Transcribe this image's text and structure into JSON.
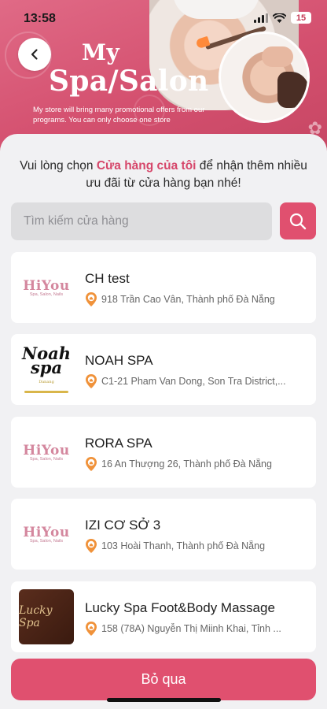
{
  "status_bar": {
    "time": "13:58",
    "battery": "15"
  },
  "header": {
    "title_line1": "My",
    "title_line2": "Spa/Salon",
    "subtitle": "My store will bring many promotional offers from our programs. You can only choose one store"
  },
  "prompt": {
    "before": "Vui lòng chọn ",
    "highlight": "Cửa hàng của tôi",
    "after": " để nhận thêm nhiều ưu đãi từ cửa hàng bạn nhé!"
  },
  "search": {
    "placeholder": "Tìm kiếm cửa hàng",
    "value": ""
  },
  "logos": {
    "hiyou_main": "HiYou",
    "hiyou_tagline": "Spa, Salon, Nails",
    "noah_main": "Noah spa",
    "noah_sub": "Danang",
    "lucky_main": "Lucky Spa"
  },
  "stores": [
    {
      "name": "CH test",
      "address": "918 Trần Cao Vân, Thành phố Đà Nẵng",
      "logo": "hiyou"
    },
    {
      "name": "NOAH SPA",
      "address": "C1-21 Pham Van Dong, Son Tra District,...",
      "logo": "noah"
    },
    {
      "name": "RORA SPA",
      "address": "16 An Thượng 26, Thành phố Đà Nẵng",
      "logo": "hiyou"
    },
    {
      "name": "IZI CƠ SỞ 3",
      "address": "103 Hoài Thanh, Thành phố Đà Nẵng",
      "logo": "hiyou"
    },
    {
      "name": "Lucky Spa Foot&Body Massage",
      "address": "158 (78A) Nguyễn Thị Miinh Khai, Tỉnh ...",
      "logo": "lucky"
    }
  ],
  "footer": {
    "skip_label": "Bỏ qua"
  },
  "colors": {
    "accent": "#e0506f",
    "header_bg": "#d4506f",
    "highlight_text": "#d6466a",
    "pin": "#f0923a"
  }
}
